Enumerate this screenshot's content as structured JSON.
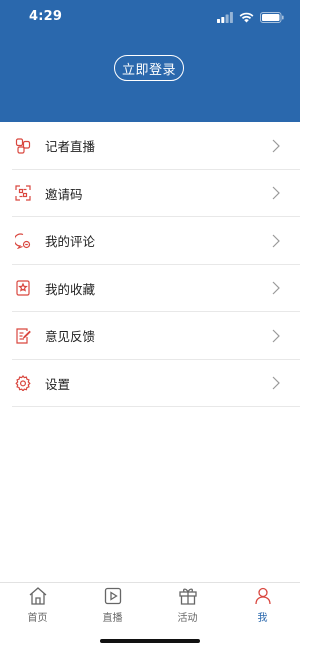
{
  "status": {
    "time": "4:29"
  },
  "header": {
    "login_label": "立即登录"
  },
  "menu": [
    {
      "label": "记者直播",
      "icon": "reporter-live-icon"
    },
    {
      "label": "邀请码",
      "icon": "invite-code-icon"
    },
    {
      "label": "我的评论",
      "icon": "comment-icon"
    },
    {
      "label": "我的收藏",
      "icon": "favorites-icon"
    },
    {
      "label": "意见反馈",
      "icon": "feedback-icon"
    },
    {
      "label": "设置",
      "icon": "settings-icon"
    }
  ],
  "tabs": [
    {
      "label": "首页",
      "icon": "home-icon",
      "active": false
    },
    {
      "label": "直播",
      "icon": "play-icon",
      "active": false
    },
    {
      "label": "活动",
      "icon": "gift-icon",
      "active": false
    },
    {
      "label": "我",
      "icon": "profile-icon",
      "active": true
    }
  ],
  "colors": {
    "brand": "#2a68ad",
    "icon_red": "#d9473f",
    "inactive": "#666666"
  }
}
